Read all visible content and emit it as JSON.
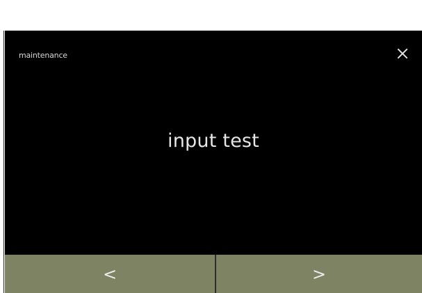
{
  "screen": {
    "title": "maintenance",
    "main_label": "input test"
  },
  "icons": {
    "close": "close-icon",
    "prev": "chevron-left-icon",
    "next": "chevron-right-icon"
  },
  "nav": {
    "prev_label": "<",
    "next_label": ">"
  },
  "colors": {
    "screen_background": "#000000",
    "nav_button": "#7e8463",
    "text": "#e6e6e6"
  }
}
